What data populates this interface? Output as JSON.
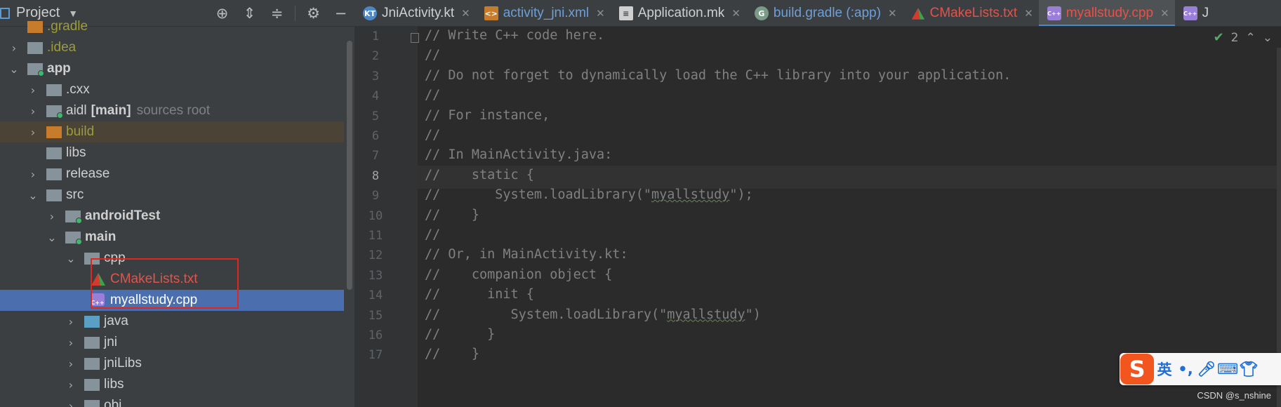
{
  "project_panel": {
    "title": "Project",
    "tools": [
      "locate-icon",
      "expand-all-icon",
      "collapse-all-icon",
      "gear-icon",
      "minimize-icon"
    ],
    "tree": [
      {
        "label": ".gradle",
        "style": "olive",
        "folder": "orange",
        "arrow": ""
      },
      {
        "label": ".idea",
        "style": "olive",
        "folder": "gray",
        "arrow": "collapsed"
      },
      {
        "label": "app",
        "style": "bold",
        "folder": "gray",
        "arrow": "expanded",
        "module": true
      },
      {
        "label": ".cxx",
        "style": "",
        "folder": "gray",
        "arrow": "collapsed"
      },
      {
        "label": "aidl",
        "extra": "[main]",
        "hint": "sources root",
        "style": "",
        "folder": "gray",
        "arrow": "collapsed",
        "module": true
      },
      {
        "label": "build",
        "style": "olive",
        "folder": "orange",
        "arrow": "collapsed"
      },
      {
        "label": "libs",
        "style": "",
        "folder": "gray",
        "arrow": ""
      },
      {
        "label": "release",
        "style": "",
        "folder": "gray",
        "arrow": "collapsed"
      },
      {
        "label": "src",
        "style": "",
        "folder": "gray",
        "arrow": "expanded"
      },
      {
        "label": "androidTest",
        "style": "bold",
        "folder": "gray",
        "arrow": "collapsed",
        "module": true
      },
      {
        "label": "main",
        "style": "bold",
        "folder": "gray",
        "arrow": "expanded",
        "module": true
      },
      {
        "label": "cpp",
        "style": "",
        "folder": "gray",
        "arrow": "expanded"
      },
      {
        "label": "CMakeLists.txt",
        "style": "red",
        "file": "cmake"
      },
      {
        "label": "myallstudy.cpp",
        "style": "white",
        "file": "cpp",
        "selected": true
      },
      {
        "label": "java",
        "style": "",
        "folder": "teal",
        "arrow": "collapsed"
      },
      {
        "label": "jni",
        "style": "",
        "folder": "gray",
        "arrow": "collapsed"
      },
      {
        "label": "jniLibs",
        "style": "",
        "folder": "gray",
        "arrow": "collapsed"
      },
      {
        "label": "libs",
        "style": "",
        "folder": "gray",
        "arrow": "collapsed"
      },
      {
        "label": "obj",
        "style": "",
        "folder": "gray",
        "arrow": "collapsed"
      }
    ]
  },
  "tabs": [
    {
      "label": "JniActivity.kt",
      "icon": "kotlin-file-icon",
      "ic": "KT",
      "color": "white"
    },
    {
      "label": "activity_jni.xml",
      "icon": "xml-file-icon",
      "ic": "<>",
      "color": "blue"
    },
    {
      "label": "Application.mk",
      "icon": "text-file-icon",
      "ic": "≡",
      "color": "white"
    },
    {
      "label": "build.gradle (:app)",
      "icon": "gradle-file-icon",
      "ic": "G",
      "color": "blue"
    },
    {
      "label": "CMakeLists.txt",
      "icon": "cmake-file-icon",
      "ic": "▲",
      "color": "red"
    },
    {
      "label": "myallstudy.cpp",
      "icon": "cpp-file-icon",
      "ic": "C++",
      "color": "red",
      "active": true
    },
    {
      "label": "J",
      "icon": "cpp-file-icon",
      "ic": "C++",
      "color": "white"
    }
  ],
  "editor": {
    "inspection_count": "2",
    "current_line": 8,
    "lines": [
      "// Write C++ code here.",
      "//",
      "// Do not forget to dynamically load the C++ library into your application.",
      "//",
      "// For instance,",
      "//",
      "// In MainActivity.java:",
      "//    static {",
      "//       System.loadLibrary(\"myallstudy\");",
      "//    }",
      "//",
      "// Or, in MainActivity.kt:",
      "//    companion object {",
      "//      init {",
      "//         System.loadLibrary(\"myallstudy\")",
      "//      }",
      "//    }"
    ]
  },
  "ime": {
    "logo": "S",
    "lang": "英",
    "punct": "•,",
    "items": [
      "microphone-icon",
      "keyboard-icon",
      "shirt-icon"
    ]
  },
  "watermark": "CSDN @s_nshine"
}
